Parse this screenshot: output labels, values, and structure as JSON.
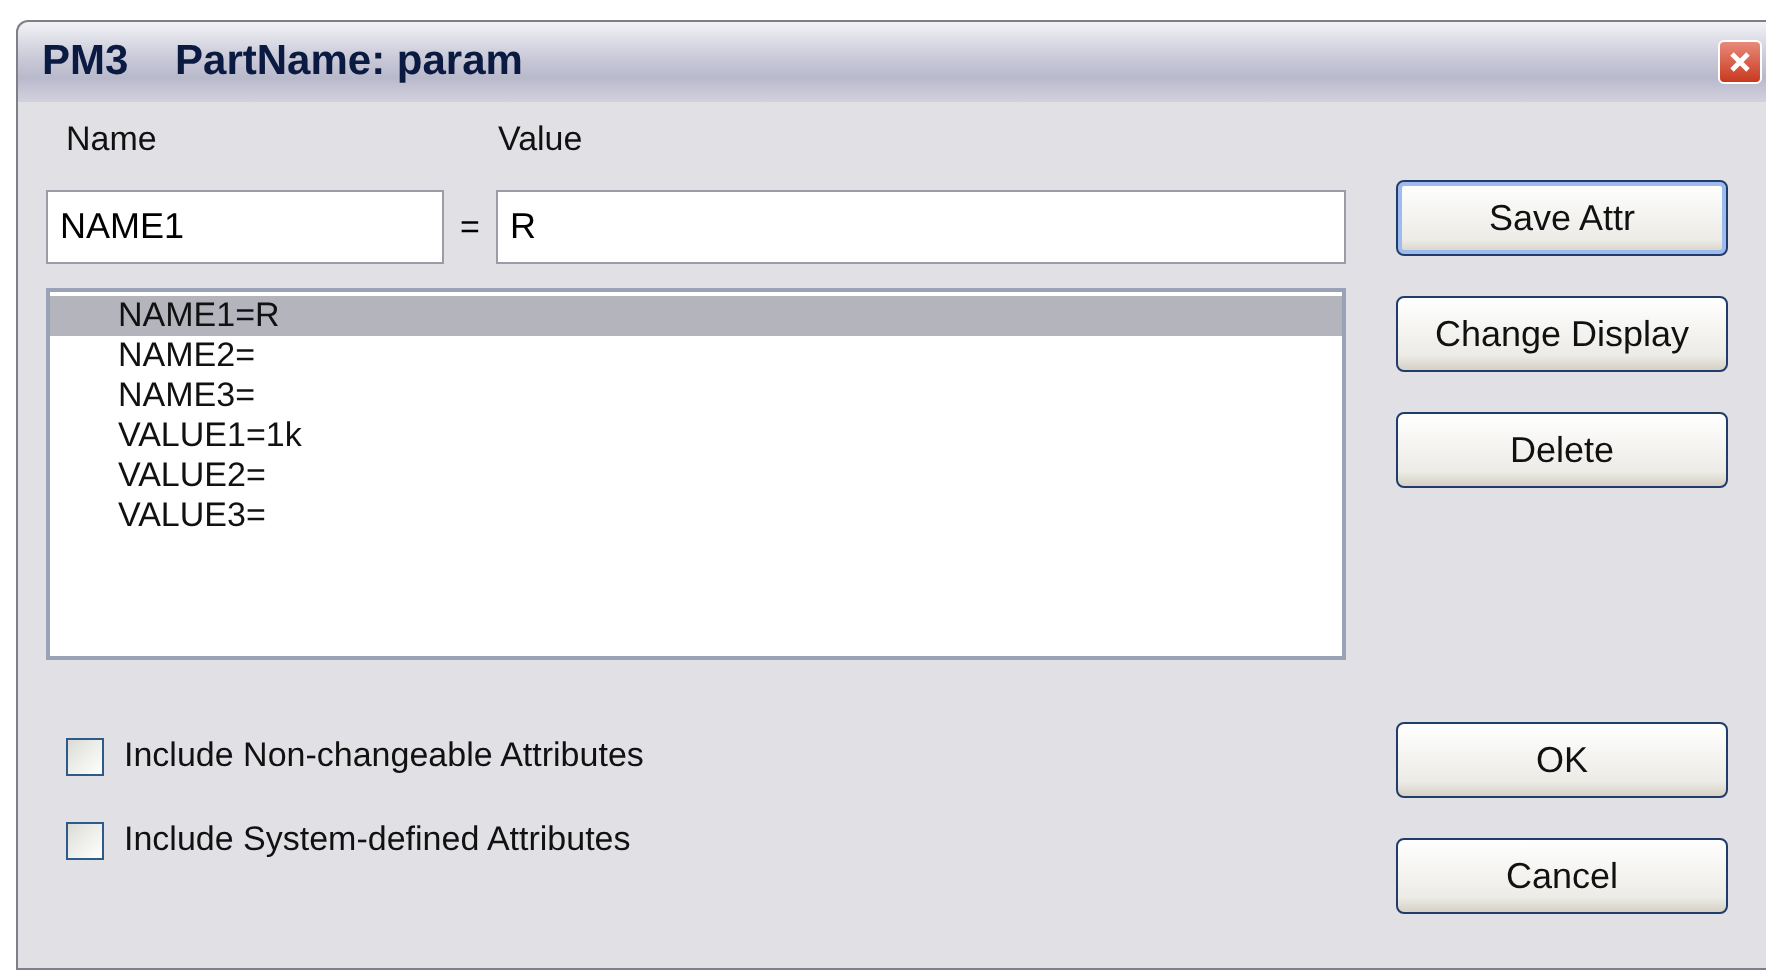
{
  "window": {
    "title": "PM3    PartName: param"
  },
  "labels": {
    "name": "Name",
    "value": "Value",
    "equals": "="
  },
  "fields": {
    "name": "NAME1",
    "value": "R"
  },
  "attributes": [
    {
      "text": "NAME1=R",
      "selected": true
    },
    {
      "text": "NAME2=",
      "selected": false
    },
    {
      "text": "NAME3=",
      "selected": false
    },
    {
      "text": "VALUE1=1k",
      "selected": false
    },
    {
      "text": "VALUE2=",
      "selected": false
    },
    {
      "text": "VALUE3=",
      "selected": false
    }
  ],
  "options": [
    {
      "label": "Include Non-changeable Attributes",
      "checked": false
    },
    {
      "label": "Include System-defined Attributes",
      "checked": false
    }
  ],
  "side_buttons": [
    "Save Attr",
    "Change Display",
    "Delete"
  ],
  "dialog_buttons": [
    "OK",
    "Cancel"
  ]
}
